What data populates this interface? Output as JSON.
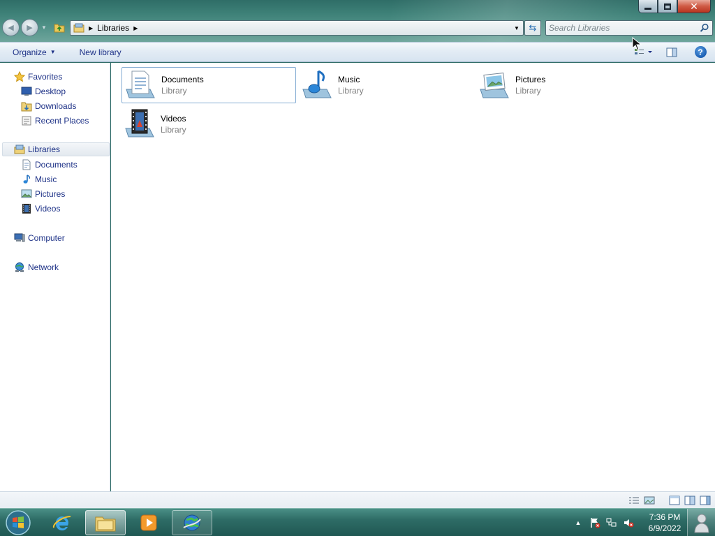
{
  "window": {
    "title": "Libraries",
    "controls": {
      "minimize": "minimize",
      "maximize": "maximize",
      "close": "✕"
    }
  },
  "address_bar": {
    "path": [
      "Libraries"
    ],
    "search_placeholder": "Search Libraries"
  },
  "command_bar": {
    "organize_label": "Organize",
    "new_library_label": "New library"
  },
  "nav_pane": {
    "favorites": {
      "label": "Favorites",
      "items": [
        {
          "label": "Desktop",
          "icon": "desktop-icon"
        },
        {
          "label": "Downloads",
          "icon": "downloads-folder-icon"
        },
        {
          "label": "Recent Places",
          "icon": "recent-places-icon"
        }
      ]
    },
    "libraries": {
      "label": "Libraries",
      "items": [
        {
          "label": "Documents",
          "icon": "documents-icon"
        },
        {
          "label": "Music",
          "icon": "music-icon"
        },
        {
          "label": "Pictures",
          "icon": "pictures-icon"
        },
        {
          "label": "Videos",
          "icon": "videos-icon"
        }
      ]
    },
    "computer": {
      "label": "Computer"
    },
    "network": {
      "label": "Network"
    }
  },
  "content": {
    "tiles": [
      {
        "name": "Documents",
        "type": "Library",
        "icon": "documents-library-icon"
      },
      {
        "name": "Music",
        "type": "Library",
        "icon": "music-library-icon"
      },
      {
        "name": "Pictures",
        "type": "Library",
        "icon": "pictures-library-icon"
      },
      {
        "name": "Videos",
        "type": "Library",
        "icon": "videos-library-icon"
      }
    ]
  },
  "taskbar": {
    "clock_time": "7:36 PM",
    "clock_date": "6/9/2022",
    "pinned": [
      "internet-explorer-icon",
      "file-explorer-icon",
      "media-player-icon",
      "network-globe-icon"
    ]
  },
  "colors": {
    "link_text": "#1e3287",
    "selection_border": "#84acd3",
    "taskbar": "#2e6c66"
  }
}
